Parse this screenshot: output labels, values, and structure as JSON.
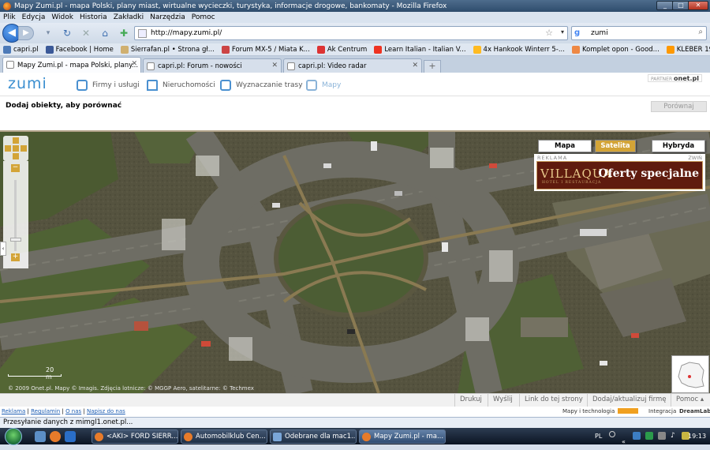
{
  "window": {
    "title": "Mapy Zumi.pl - mapa Polski, plany miast, wirtualne wycieczki, turystyka, informacje drogowe, bankomaty - Mozilla Firefox",
    "controls": [
      "_",
      "□",
      "✕"
    ]
  },
  "menu": [
    "Plik",
    "Edycja",
    "Widok",
    "Historia",
    "Zakładki",
    "Narzędzia",
    "Pomoc"
  ],
  "nav": {
    "url": "http://mapy.zumi.pl/",
    "search_value": "zumi",
    "search_engine": "g"
  },
  "bookmarks": [
    {
      "label": "capri.pl",
      "color": "#4d7ab8"
    },
    {
      "label": "Facebook | Home",
      "color": "#3b5998"
    },
    {
      "label": "Sierrafan.pl • Strona gł...",
      "color": "#d0b070"
    },
    {
      "label": "Forum MX-5 / Miata K...",
      "color": "#c44"
    },
    {
      "label": "Ak Centrum",
      "color": "#d33"
    },
    {
      "label": "Learn Italian - Italian V...",
      "color": "#e32"
    },
    {
      "label": "4x Hankook Winterr 5-...",
      "color": "#fb2"
    },
    {
      "label": "Komplet opon - Good...",
      "color": "#e84"
    },
    {
      "label": "KLEBER 195 / 55 R15 (8...",
      "color": "#f90"
    }
  ],
  "tabs": [
    {
      "label": "Mapy Zumi.pl - mapa Polski, plany...",
      "active": true
    },
    {
      "label": "capri.pl: Forum - nowości",
      "active": false
    },
    {
      "label": "capri.pl: Video radar",
      "active": false
    }
  ],
  "new_tab": "+",
  "zumi": {
    "logo": "zumi",
    "tabs": [
      {
        "label": "Firmy i usługi",
        "active": false
      },
      {
        "label": "Nieruchomości",
        "active": false
      },
      {
        "label": "Wyznaczanie trasy",
        "active": false
      },
      {
        "label": "Mapy",
        "active": true
      }
    ],
    "partner_label": "PARTNER",
    "partner_brand": "onet.pl"
  },
  "compare": {
    "title": "Dodaj obiekty, aby porównać",
    "button": "Porównaj"
  },
  "map": {
    "types": [
      {
        "label": "Mapa",
        "active": false
      },
      {
        "label": "Satelita",
        "active": true
      },
      {
        "label": "Hybryda",
        "active": false
      }
    ],
    "ad": {
      "label": "REKLAMA",
      "collapse": "ZWIŃ",
      "logo": "VILLAQUA",
      "logo_sub": "HOTEL I RESTAURACJA",
      "text": "Oferty specjalne"
    },
    "scale_label": "20 m",
    "copyright": "© 2009 Onet.pl. Mapy © Imagis. Zdjęcia lotnicze: © MGGP Aero, satelitarne: © Techmex"
  },
  "map_footer": [
    "Drukuj",
    "Wyślij",
    "Link do tej strony",
    "Dodaj/aktualizuj firmę",
    "Pomoc ▴"
  ],
  "page_footer": {
    "links": [
      "Reklama",
      "Regulamin",
      "O nas",
      "Napisz do nas"
    ],
    "right": [
      "Mapy i technologia",
      "Integracja",
      "DreamLab"
    ]
  },
  "status": "Przesyłanie danych z mimgl1.onet.pl...",
  "taskbar": {
    "tasks": [
      {
        "label": "<AKI> FORD SIERR...",
        "active": false
      },
      {
        "label": "Automobilklub Cen...",
        "active": false
      },
      {
        "label": "Odebrane dla mac1...",
        "active": false
      },
      {
        "label": "Mapy Zumi.pl - ma...",
        "active": true
      }
    ],
    "lang": "PL",
    "clock": "19:13"
  }
}
